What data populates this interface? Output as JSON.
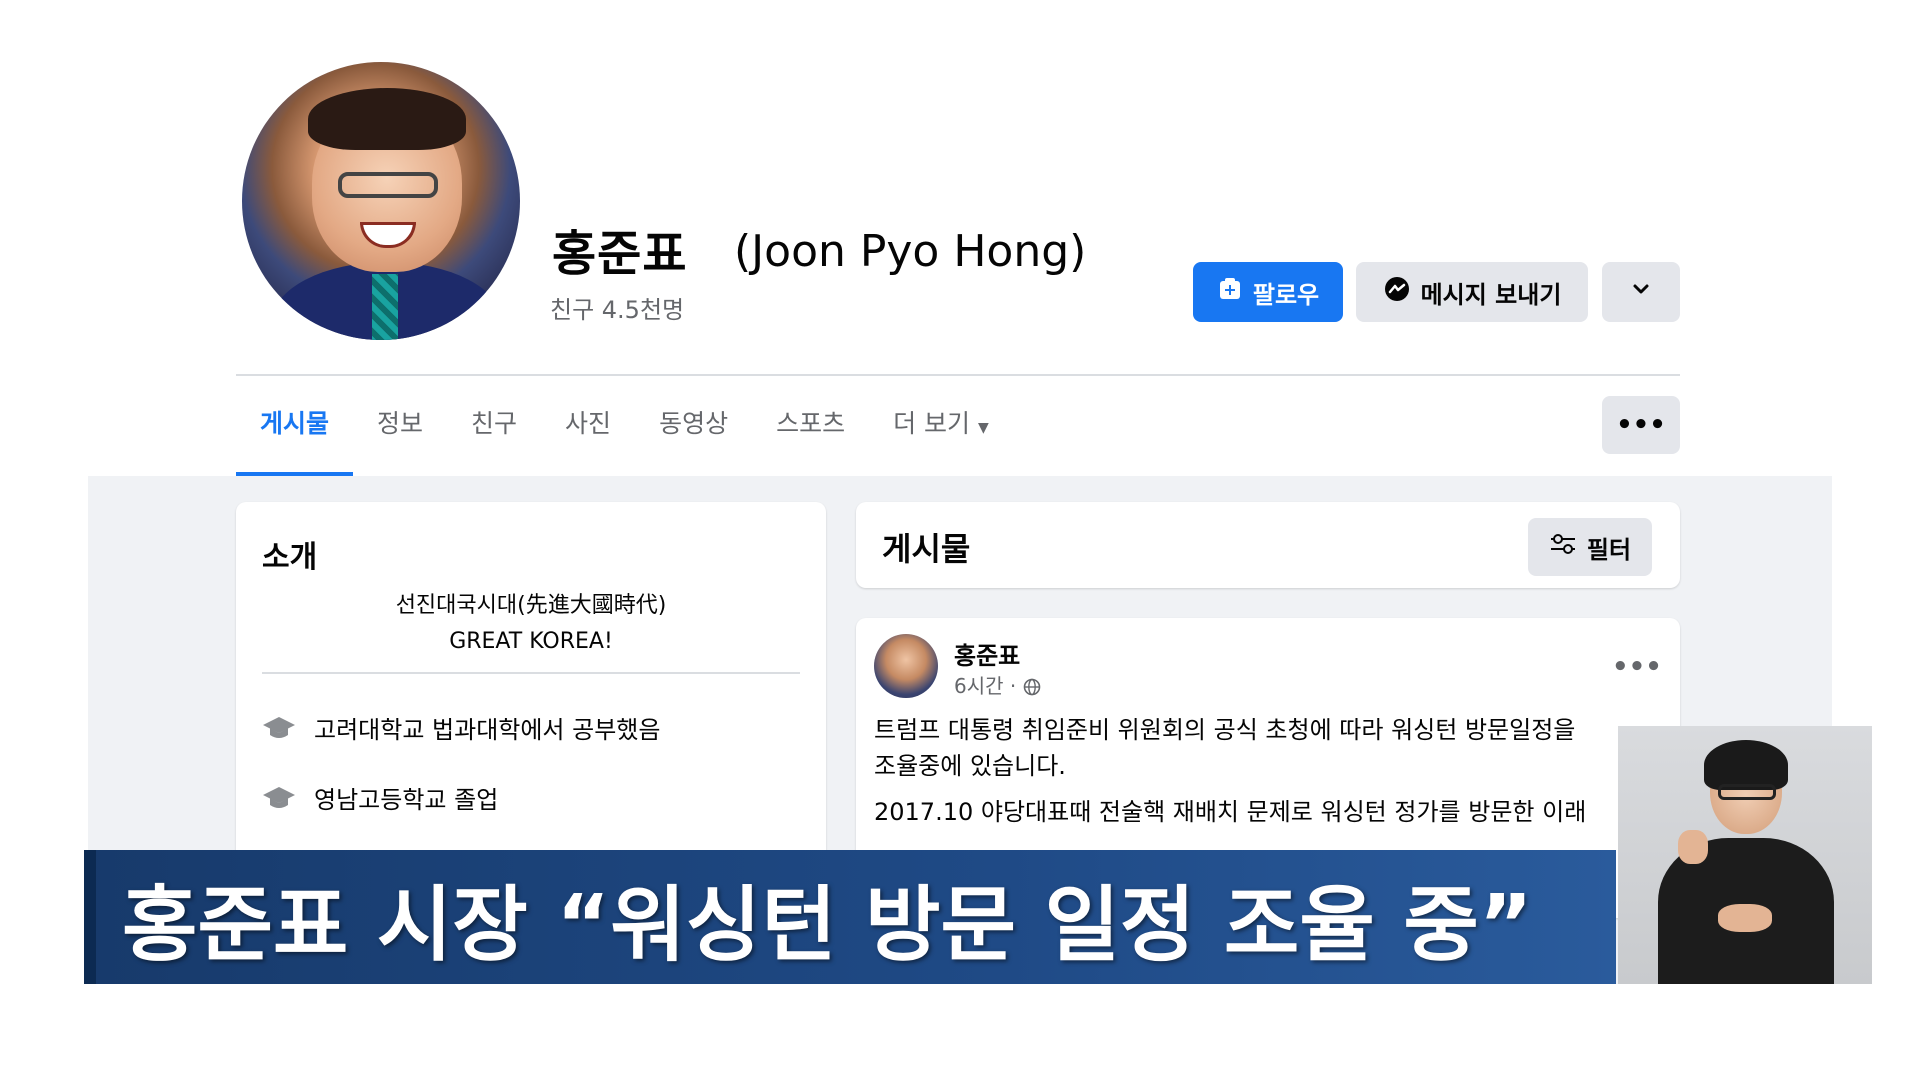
{
  "profile": {
    "name": "홍준표",
    "name_en": "(Joon Pyo Hong)",
    "friends": "친구 4.5천명"
  },
  "actions": {
    "follow": "팔로우",
    "message": "메시지 보내기",
    "more_icon": "chevron-down-icon",
    "follow_icon": "add-friend-icon",
    "message_icon": "messenger-icon"
  },
  "tabs": [
    {
      "label": "게시물",
      "active": true
    },
    {
      "label": "정보"
    },
    {
      "label": "친구"
    },
    {
      "label": "사진"
    },
    {
      "label": "동영상"
    },
    {
      "label": "스포츠"
    },
    {
      "label": "더 보기"
    }
  ],
  "tabs_more_icon": "ellipsis-icon",
  "intro": {
    "title": "소개",
    "bio_line1": "선진대국시대(先進大國時代)",
    "bio_line2": "GREAT KOREA!",
    "items": [
      {
        "icon": "graduation-cap-icon",
        "text": "고려대학교 법과대학에서 공부했음"
      },
      {
        "icon": "graduation-cap-icon",
        "text": "영남고등학교 졸업"
      }
    ]
  },
  "posts": {
    "title": "게시물",
    "filter_label": "필터",
    "filter_icon": "sliders-icon"
  },
  "post": {
    "author": "홍준표",
    "time": "6시간 ·",
    "privacy_icon": "globe-icon",
    "line1": "트럼프 대통령 취임준비 위원회의 공식 초청에 따라 워싱턴 방문일정을",
    "line2": "조율중에 있습니다.",
    "line3": "2017.10 야당대표때 전술핵 재배치 문제로 워싱턴 정가를 방문한 이래"
  },
  "caption": {
    "text": "홍준표 시장 “워싱턴 방문 일정 조율 중”"
  },
  "colors": {
    "primary": "#1877f2",
    "button_grey": "#e4e6eb",
    "page_bg": "#f0f2f5",
    "caption_band": "#1f4a86"
  }
}
